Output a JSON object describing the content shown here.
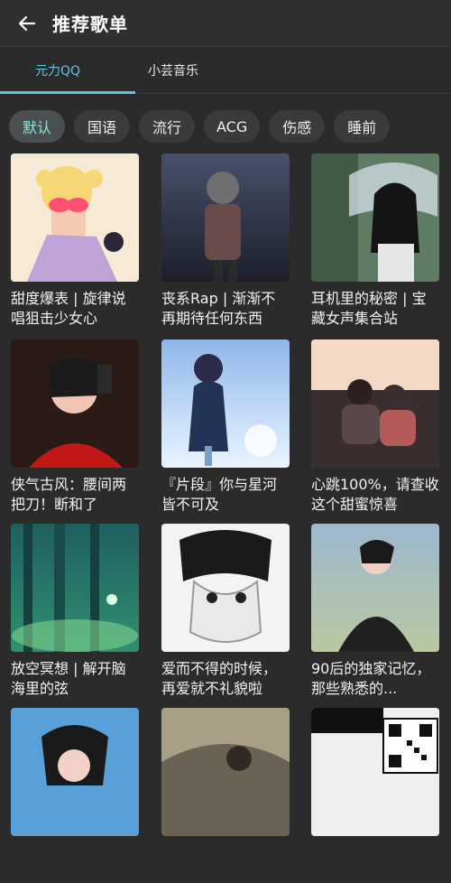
{
  "header": {
    "title": "推荐歌单",
    "back_icon": "arrow-left-icon"
  },
  "tabs": [
    {
      "label": "元力QQ",
      "active": true
    },
    {
      "label": "小芸音乐",
      "active": false
    }
  ],
  "chips": [
    {
      "label": "默认",
      "active": true
    },
    {
      "label": "国语",
      "active": false
    },
    {
      "label": "流行",
      "active": false
    },
    {
      "label": "ACG",
      "active": false
    },
    {
      "label": "伤感",
      "active": false
    },
    {
      "label": "睡前",
      "active": false
    }
  ],
  "playlists": [
    {
      "title": "甜度爆表 | 旋律说唱狙击少女心"
    },
    {
      "title": "丧系Rap | 渐渐不再期待任何东西"
    },
    {
      "title": "耳机里的秘密 | 宝藏女声集合站"
    },
    {
      "title": "侠气古风：腰间两把刀！断和了"
    },
    {
      "title": "『片段』你与星河皆不可及"
    },
    {
      "title": "心跳100%，请查收这个甜蜜惊喜"
    },
    {
      "title": "放空冥想 | 解开脑海里的弦"
    },
    {
      "title": "爱而不得的时候，再爱就不礼貌啦"
    },
    {
      "title": "90后的独家记忆，那些熟悉的..."
    },
    {
      "title": ""
    },
    {
      "title": ""
    },
    {
      "title": ""
    }
  ],
  "colors": {
    "accent": "#5ec6e0",
    "background": "#2b2b2b"
  }
}
